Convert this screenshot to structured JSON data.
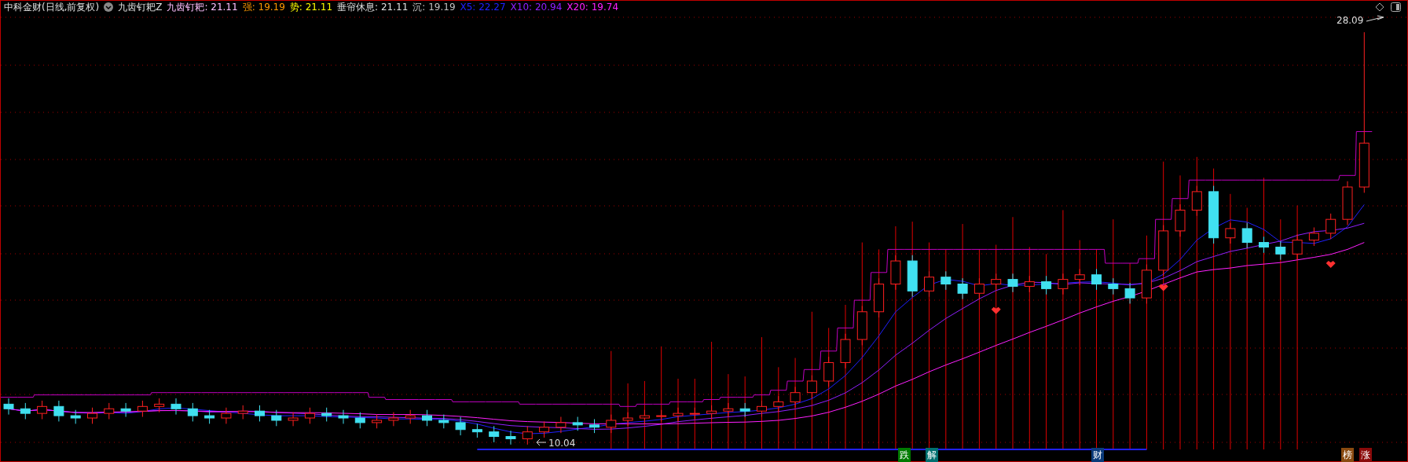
{
  "header": {
    "stock_title": "中科金财(日线,前复权)",
    "indicator_name": "九齿钉耙Z",
    "indicators": [
      {
        "label": "九齿钉耙: ",
        "value": "21.11",
        "color": "#ffc0ff"
      },
      {
        "label": "强: ",
        "value": "19.19",
        "color": "#ff9900"
      },
      {
        "label": "势: ",
        "value": "21.11",
        "color": "#ffff00"
      },
      {
        "label": "垂帘休息: ",
        "value": "21.11",
        "color": "#e0e0e0"
      },
      {
        "label": "沉: ",
        "value": "19.19",
        "color": "#c0c0c0"
      },
      {
        "label": "X5: ",
        "value": "22.27",
        "color": "#2020ff"
      },
      {
        "label": "X10: ",
        "value": "20.94",
        "color": "#9020ff"
      },
      {
        "label": "X20: ",
        "value": "19.74",
        "color": "#ff20ff"
      }
    ]
  },
  "price_labels": {
    "high": "28.09",
    "low": "10.04"
  },
  "badges": [
    {
      "text": "跌",
      "color": "#007a00"
    },
    {
      "text": "解",
      "color": "#007070"
    },
    {
      "text": "财",
      "color": "#0a3a7a"
    },
    {
      "text": "榜",
      "color": "#8a4a10"
    },
    {
      "text": "涨",
      "color": "#8a0a0a"
    }
  ]
}
